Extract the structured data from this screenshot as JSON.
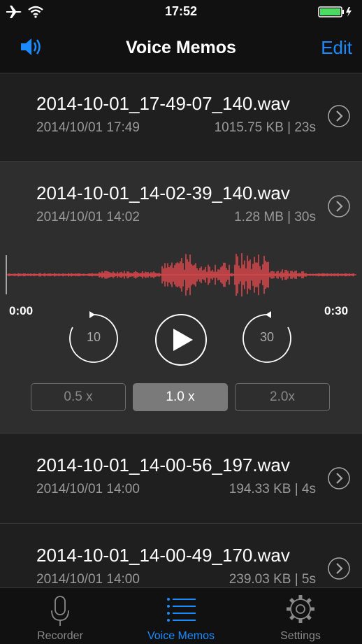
{
  "status_bar": {
    "time": "17:52"
  },
  "nav": {
    "title": "Voice Memos",
    "edit_label": "Edit",
    "speaker_icon": "speaker-icon",
    "accent": "#1a8cff"
  },
  "memos": [
    {
      "name": "2014-10-01_17-49-07_140.wav",
      "date": "2014/10/01 17:49",
      "meta": "1015.75 KB | 23s"
    },
    {
      "name": "2014-10-01_14-02-39_140.wav",
      "date": "2014/10/01 14:02",
      "meta": "1.28 MB | 30s"
    },
    {
      "name": "2014-10-01_14-00-56_197.wav",
      "date": "2014/10/01 14:00",
      "meta": "194.33 KB |  4s"
    },
    {
      "name": "2014-10-01_14-00-49_170.wav",
      "date": "2014/10/01 14:00",
      "meta": "239.03 KB |  5s"
    }
  ],
  "player": {
    "start_time": "0:00",
    "end_time": "0:30",
    "skip_back": "10",
    "skip_forward": "30",
    "waveform_color": "#d9474c",
    "speeds": [
      "0.5 x",
      "1.0 x",
      "2.0x"
    ],
    "selected_speed": "1.0 x"
  },
  "tabs": [
    {
      "label": "Recorder",
      "icon": "microphone-icon"
    },
    {
      "label": "Voice Memos",
      "icon": "list-icon"
    },
    {
      "label": "Settings",
      "icon": "gear-icon"
    }
  ],
  "active_tab": "Voice Memos"
}
